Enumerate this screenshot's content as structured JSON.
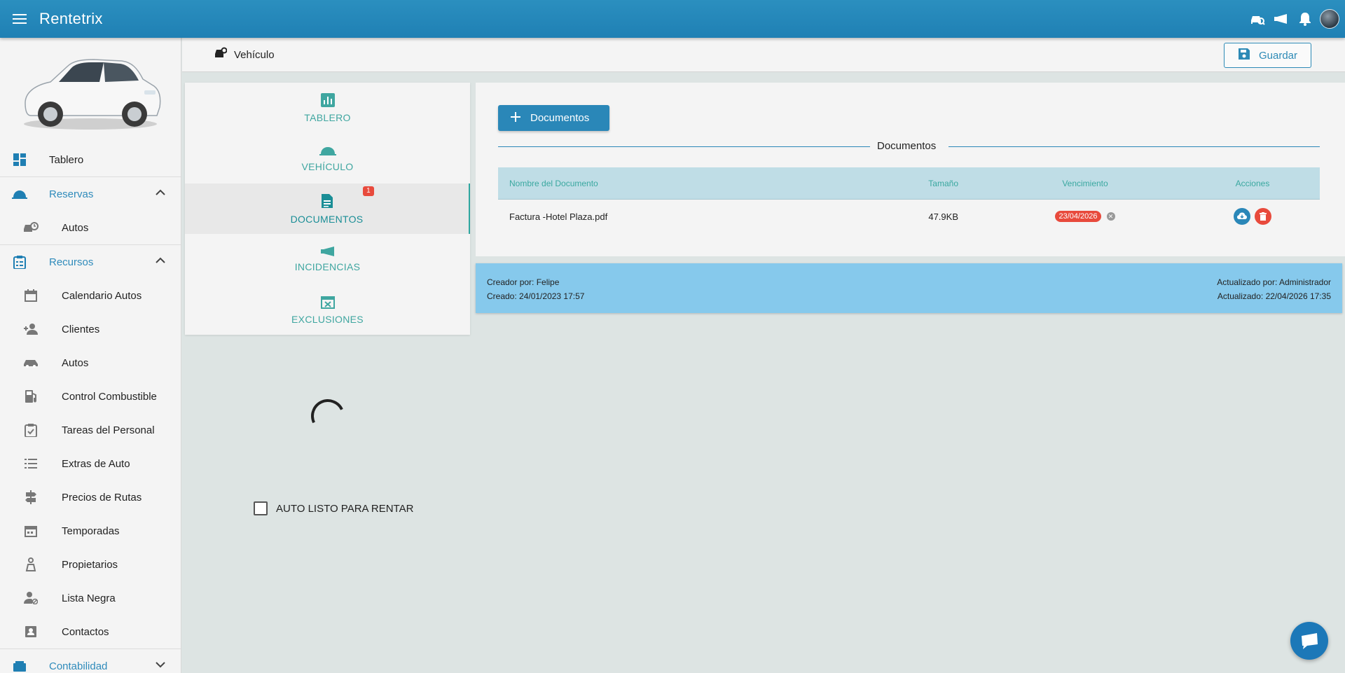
{
  "app": {
    "title": "Rentetrix"
  },
  "header": {
    "section_title": "Vehículo",
    "save_label": "Guardar"
  },
  "sidebar": {
    "items": [
      {
        "label": "Tablero",
        "icon": "dashboard-icon"
      },
      {
        "label": "Reservas",
        "icon": "bell-service-icon"
      },
      {
        "label": "Autos",
        "icon": "car-clock-icon"
      },
      {
        "label": "Recursos",
        "icon": "clipboard-icon"
      },
      {
        "label": "Calendario Autos",
        "icon": "calendar-icon"
      },
      {
        "label": "Clientes",
        "icon": "users-icon"
      },
      {
        "label": "Autos",
        "icon": "car-icon"
      },
      {
        "label": "Control Combustible",
        "icon": "fuel-icon"
      },
      {
        "label": "Tareas del Personal",
        "icon": "clipboard-check-icon"
      },
      {
        "label": "Extras de Auto",
        "icon": "list-icon"
      },
      {
        "label": "Precios de Rutas",
        "icon": "signpost-icon"
      },
      {
        "label": "Temporadas",
        "icon": "calendar-icon"
      },
      {
        "label": "Propietarios",
        "icon": "owner-icon"
      },
      {
        "label": "Lista Negra",
        "icon": "user-block-icon"
      },
      {
        "label": "Contactos",
        "icon": "contacts-icon"
      },
      {
        "label": "Contabilidad",
        "icon": "accounting-icon"
      }
    ]
  },
  "tabs": [
    {
      "label": "TABLERO",
      "icon": "chart-icon"
    },
    {
      "label": "VEHÍCULO",
      "icon": "vehicle-icon"
    },
    {
      "label": "DOCUMENTOS",
      "icon": "document-icon",
      "badge": "1"
    },
    {
      "label": "INCIDENCIAS",
      "icon": "horn-icon"
    },
    {
      "label": "EXCLUSIONES",
      "icon": "calendar-x-icon"
    }
  ],
  "checkbox": {
    "label": "AUTO LISTO PARA RENTAR",
    "checked": false
  },
  "documents": {
    "add_label": "Documentos",
    "section_title": "Documentos",
    "columns": [
      "Nombre del Documento",
      "Tamaño",
      "Vencimiento",
      "Acciones"
    ],
    "rows": [
      {
        "name": "Factura -Hotel Plaza.pdf",
        "size": "47.9KB",
        "expires": "23/04/2026"
      }
    ]
  },
  "audit": {
    "created_by": "Creador por: Felipe",
    "created_at": "Creado: 24/01/2023 17:57",
    "updated_by": "Actualizado por: Administrador",
    "updated_at": "Actualizado: 22/04/2026 17:35"
  },
  "colors": {
    "primary": "#2a87b8",
    "teal": "#3fa6a0",
    "danger": "#e84a3c",
    "info": "#86c9ec"
  }
}
